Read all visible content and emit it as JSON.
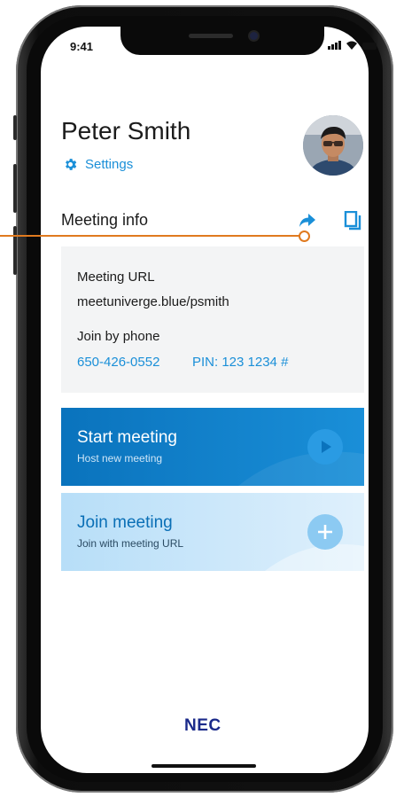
{
  "status_bar": {
    "time": "9:41"
  },
  "profile": {
    "name": "Peter Smith",
    "settings_label": "Settings"
  },
  "meeting_info": {
    "title": "Meeting info",
    "url_label": "Meeting URL",
    "url_value": "meetuniverge.blue/psmith",
    "phone_label": "Join by phone",
    "phone_number": "650-426-0552",
    "pin": "PIN: 123 1234 #"
  },
  "actions": {
    "start": {
      "title": "Start meeting",
      "subtitle": "Host new meeting"
    },
    "join": {
      "title": "Join meeting",
      "subtitle": "Join with meeting URL"
    }
  },
  "brand": {
    "logo": "NEC"
  },
  "colors": {
    "accent": "#1a8fd8",
    "callout": "#e07a1f",
    "start_button": "#0a73bd",
    "join_button": "#b7def8"
  },
  "icons": [
    "gear-icon",
    "share-icon",
    "copy-icon",
    "play-icon",
    "plus-icon"
  ]
}
